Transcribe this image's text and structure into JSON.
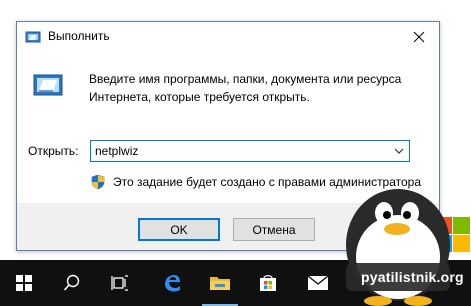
{
  "dialog": {
    "title": "Выполнить",
    "description": "Введите имя программы, папки, документа или ресурса Интернета, которые требуется открыть.",
    "open_label": "Открыть:",
    "open_value": "netplwiz",
    "admin_note": "Это задание будет создано с правами администратора",
    "ok_label": "OK",
    "cancel_label": "Отмена"
  },
  "taskbar": {
    "items": [
      {
        "icon": "windows-start-icon"
      },
      {
        "icon": "search-icon"
      },
      {
        "icon": "task-view-icon"
      },
      {
        "icon": "edge-browser-icon"
      },
      {
        "icon": "file-explorer-icon"
      },
      {
        "icon": "store-icon"
      },
      {
        "icon": "mail-icon"
      }
    ]
  },
  "watermark": {
    "text": "pyatilistnik.org"
  },
  "colors": {
    "accent": "#0078d7",
    "taskbar": "#101010",
    "footer": "#f0f0f0"
  }
}
